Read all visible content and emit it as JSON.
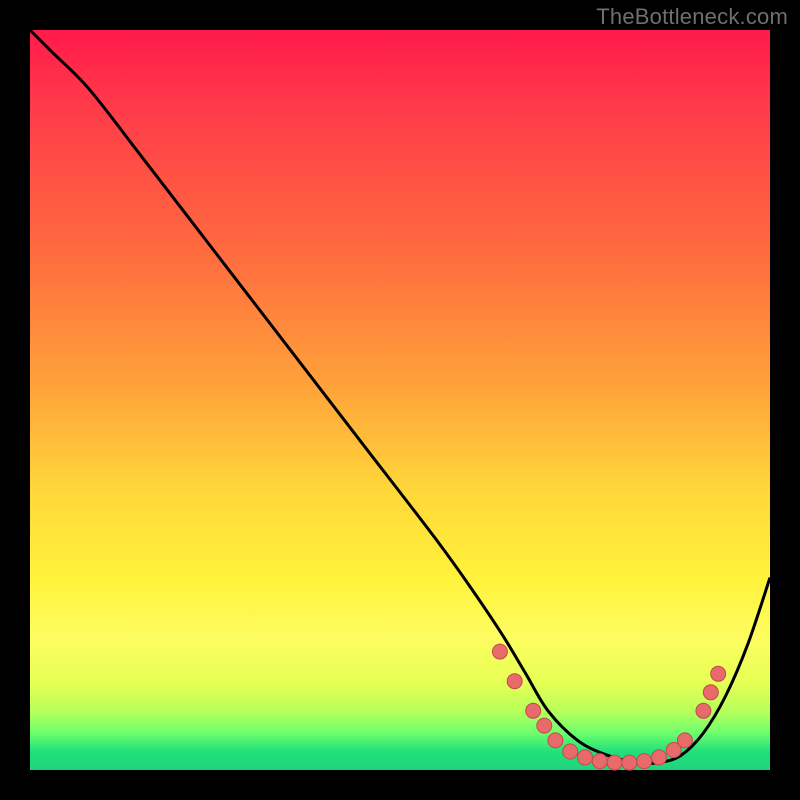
{
  "watermark": "TheBottleneck.com",
  "colors": {
    "background": "#000000",
    "curve": "#000000",
    "dots_fill": "#e86a6a",
    "dots_stroke": "#c24b4b",
    "gradient_top": "#ff1a4b",
    "gradient_bottom": "#1fd37c"
  },
  "chart_data": {
    "type": "line",
    "title": "",
    "xlabel": "",
    "ylabel": "",
    "xlim": [
      0,
      100
    ],
    "ylim": [
      0,
      100
    ],
    "series": [
      {
        "name": "curve",
        "x": [
          0,
          3,
          8,
          15,
          25,
          35,
          45,
          55,
          60,
          64,
          67,
          70,
          74,
          78,
          82,
          85,
          88,
          91,
          94,
          97,
          100
        ],
        "y": [
          100,
          97,
          92,
          83,
          70,
          57,
          44,
          31,
          24,
          18,
          13,
          8,
          4,
          2,
          1,
          1,
          2,
          5,
          10,
          17,
          26
        ]
      }
    ],
    "dots": [
      {
        "x": 63.5,
        "y": 16
      },
      {
        "x": 65.5,
        "y": 12
      },
      {
        "x": 68.0,
        "y": 8
      },
      {
        "x": 69.5,
        "y": 6
      },
      {
        "x": 71.0,
        "y": 4
      },
      {
        "x": 73.0,
        "y": 2.5
      },
      {
        "x": 75.0,
        "y": 1.7
      },
      {
        "x": 77.0,
        "y": 1.2
      },
      {
        "x": 79.0,
        "y": 1.0
      },
      {
        "x": 81.0,
        "y": 1.0
      },
      {
        "x": 83.0,
        "y": 1.2
      },
      {
        "x": 85.0,
        "y": 1.7
      },
      {
        "x": 87.0,
        "y": 2.7
      },
      {
        "x": 88.5,
        "y": 4.0
      },
      {
        "x": 91.0,
        "y": 8.0
      },
      {
        "x": 92.0,
        "y": 10.5
      },
      {
        "x": 93.0,
        "y": 13.0
      }
    ]
  }
}
